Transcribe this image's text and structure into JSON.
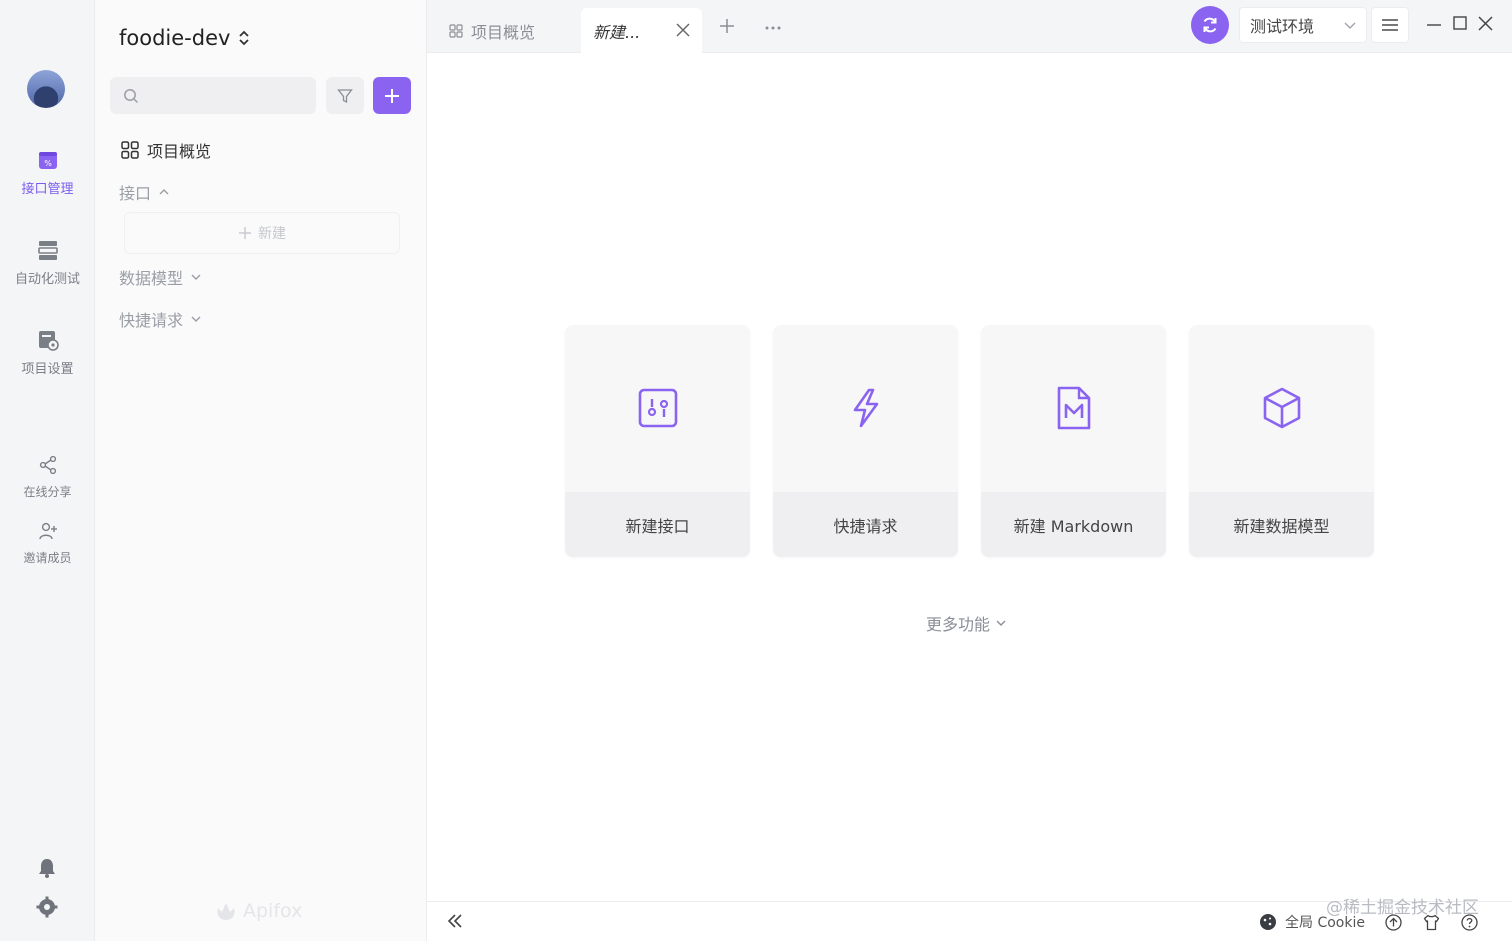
{
  "app": {
    "project_name": "foodie-dev",
    "accent_color": "#8a63f0",
    "brand_name": "Apifox",
    "watermark": "@稀土掘金技术社区"
  },
  "rail": {
    "items": [
      {
        "label": "接口管理",
        "icon": "api-management-icon",
        "active": true
      },
      {
        "label": "自动化测试",
        "icon": "automation-test-icon",
        "active": false
      },
      {
        "label": "项目设置",
        "icon": "project-settings-icon",
        "active": false
      },
      {
        "label": "在线分享",
        "icon": "share-icon",
        "active": false
      },
      {
        "label": "邀请成员",
        "icon": "invite-member-icon",
        "active": false
      }
    ],
    "bottom_icons": [
      "bell-icon",
      "gear-icon"
    ]
  },
  "sidebar": {
    "search_placeholder": "",
    "overview_label": "项目概览",
    "groups": [
      {
        "label": "接口",
        "expanded": true
      },
      {
        "label": "数据模型",
        "expanded": false
      },
      {
        "label": "快捷请求",
        "expanded": false
      }
    ],
    "new_label": "新建"
  },
  "tabs": {
    "items": [
      {
        "label": "项目概览",
        "active": false
      },
      {
        "label": "新建...",
        "active": true
      }
    ],
    "environment": "测试环境"
  },
  "main": {
    "cards": [
      {
        "label": "新建接口",
        "icon": "api-icon"
      },
      {
        "label": "快捷请求",
        "icon": "lightning-icon"
      },
      {
        "label": "新建 Markdown",
        "icon": "markdown-file-icon"
      },
      {
        "label": "新建数据模型",
        "icon": "cube-icon"
      }
    ],
    "more_label": "更多功能"
  },
  "bottombar": {
    "cookie_label": "全局 Cookie"
  }
}
